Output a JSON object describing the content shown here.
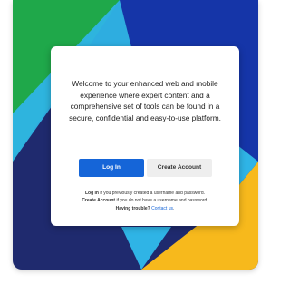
{
  "card": {
    "welcome_text": "Welcome to your enhanced web and mobile experience where expert content and a comprehensive set of tools can be found in a secure, confidential and easy-to-use platform.",
    "login_label": "Log In",
    "create_account_label": "Create Account",
    "help": {
      "line1_bold": "Log In",
      "line1_text": " if you previously created a username and password.",
      "line2_bold": "Create Account",
      "line2_text": " if you do not have a username and password.",
      "line3_bold": "Having trouble?",
      "line3_link": "Contact us",
      "line3_end": "."
    }
  },
  "colors": {
    "green": "#1fa84a",
    "dark_blue": "#1535a8",
    "navy": "#1f2a6e",
    "cyan": "#2fb4e6",
    "yellow": "#f7b91c",
    "primary_button": "#1565d8"
  }
}
